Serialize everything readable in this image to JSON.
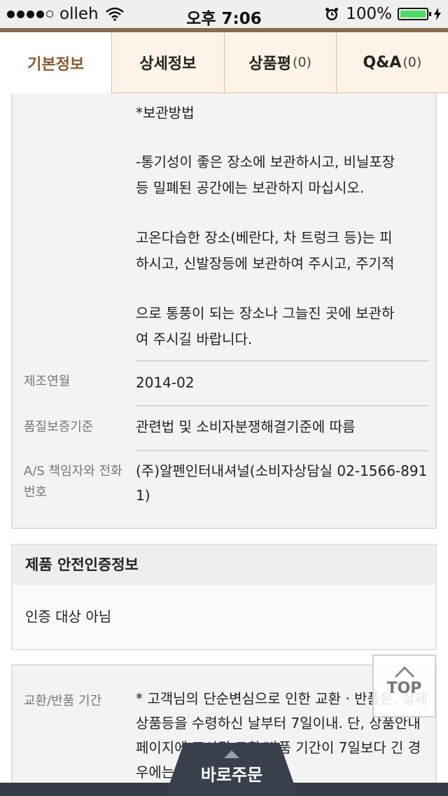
{
  "status_bar": {
    "carrier": "olleh",
    "time": "오후 7:06",
    "battery": "100%",
    "signal_bars": 4
  },
  "tabs": [
    {
      "label": "기본정보",
      "count": ""
    },
    {
      "label": "상세정보",
      "count": ""
    },
    {
      "label": "상품평",
      "count": "(0)"
    },
    {
      "label": "Q&A",
      "count": "(0)"
    }
  ],
  "storage": {
    "heading": "*보관방법",
    "lines": [
      "-통기성이 좋은 장소에 보관하시고, 비닐포장",
      "등 밀폐된 공간에는 보관하지 마십시오.",
      "고온다습한 장소(베란다, 차 트렁크 등)는 피",
      "하시고, 신발장등에 보관하여 주시고, 주기적",
      "으로 통풍이 되는 장소나 그늘진 곳에 보관하",
      "여 주시길 바랍니다."
    ]
  },
  "info_rows": [
    {
      "label": "제조연월",
      "value": "2014-02"
    },
    {
      "label": "품질보증기준",
      "value": "관련법 및 소비자분쟁해결기준에 따름"
    },
    {
      "label": "A/S 책임자와 전화번호",
      "value": "(주)알펜인터내셔널(소비자상담실 02-1566-8911)"
    }
  ],
  "safety": {
    "title": "제품 안전인증정보",
    "value": "인증 대상 아님"
  },
  "exchange": {
    "label": "교환/반품 기간",
    "text": "* 고객님의 단순변심으로 인한 교환 · 반품은, 실제 상품등을 수령하신 날부터 7일이내. 단, 상품안내 페이지에 표시된 교환/반품 기간이 7일보다 긴 경우에는 그 기간 (롯데홈쇼"
  },
  "top_button": "TOP",
  "order_button": "바로주문",
  "colors": {
    "brand_brown": "#8b6a4e",
    "active_tab_text": "#8a5a32",
    "tab_bg": "#fdf3e6",
    "bottom_bar": "#333a45"
  }
}
